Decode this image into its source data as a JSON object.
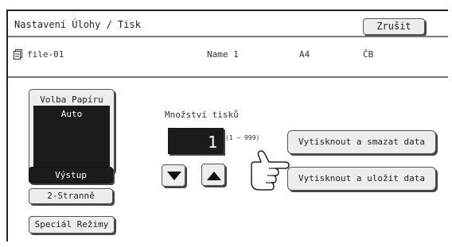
{
  "header": {
    "title": "Nastavení Úlohy / Tisk",
    "cancel_label": "Zrušit"
  },
  "job_info": {
    "icon": "file-stack-icon",
    "file_name": "file-01",
    "user_name": "Name 1",
    "paper_size": "A4",
    "color_mode": "ČB"
  },
  "paper_select": {
    "label": "Volba Papíru",
    "value": "Auto"
  },
  "left_buttons": {
    "output": "Výstup",
    "duplex": "2-Stranně",
    "special_modes": "Speciál Režimy"
  },
  "quantity": {
    "label": "Množství tisků",
    "value": "1",
    "range": "(1 ~ 999)",
    "down_icon": "triangle-down-icon",
    "up_icon": "triangle-up-icon"
  },
  "actions": {
    "print_and_delete": "Vytisknout a smazat data",
    "print_and_save": "Vytisknout a uložit data"
  },
  "pointer": {
    "icon": "pointing-hand-icon"
  }
}
